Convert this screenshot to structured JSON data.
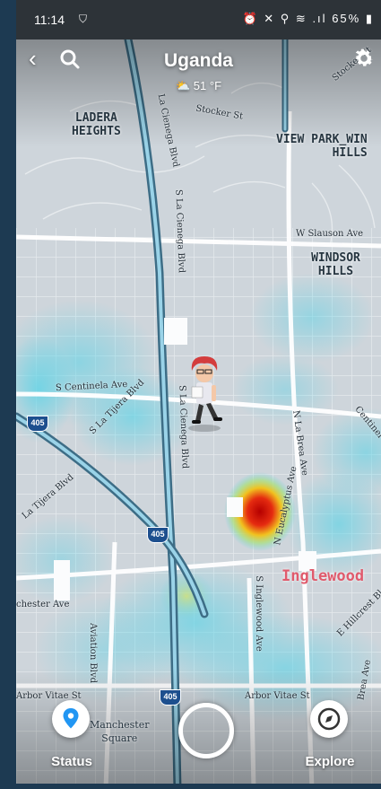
{
  "status_bar": {
    "time": "11:14",
    "shield_icon": "shield-check-icon",
    "indicators": "⏰ ✕ ⚲ ≋ .ıl",
    "battery": "65%"
  },
  "header": {
    "location_title": "Uganda",
    "weather": "51 °F",
    "weather_icon": "partly-cloudy-icon"
  },
  "map_labels": {
    "ladera_heights": "LADERA\nHEIGHTS",
    "view_park": "VIEW PARK_WIN\nHILLS",
    "windsor_hills": "WINDSOR HILLS",
    "inglewood": "Inglewood",
    "manchester_square": "Manchester\nSquare"
  },
  "streets": {
    "stocker_st": "Stocker St",
    "stocker_st_2": "Stocker St",
    "la_cienega_blvd_top": "La Cienega Blvd",
    "s_la_cienega_blvd_mid": "S La Cienega Blvd",
    "s_la_cienega_blvd_low": "S La Cienega Blvd",
    "w_slauson_ave": "W Slauson Ave",
    "s_centinela_ave": "S Centinela Ave",
    "s_la_tijera_blvd": "S La Tijera Blvd",
    "la_tijera_blvd": "La Tijera Blvd",
    "n_la_brea_ave": "N La Brea Ave",
    "n_eucalyptus_ave": "N Eucalyptus Ave",
    "centinela": "Centinel",
    "manchester_ave": "chester Ave",
    "aviation_blvd": "Aviation Blvd",
    "s_inglewood_ave": "S Inglewood Ave",
    "e_hillcrest_bl": "E Hillcrest Bl",
    "arbor_vitae_st_left": "Arbor Vitae St",
    "arbor_vitae_st_right": "Arbor Vitae St",
    "brea_ave": "Brea Ave",
    "i405_a": "405",
    "i405_b": "405",
    "i405_c": "405"
  },
  "bottom_nav": {
    "status_label": "Status",
    "explore_label": "Explore"
  },
  "colors": {
    "heat_cyan": "#5fd3e6",
    "heat_hot": "#d81e0e",
    "inglewood_label": "#e05a6c"
  }
}
